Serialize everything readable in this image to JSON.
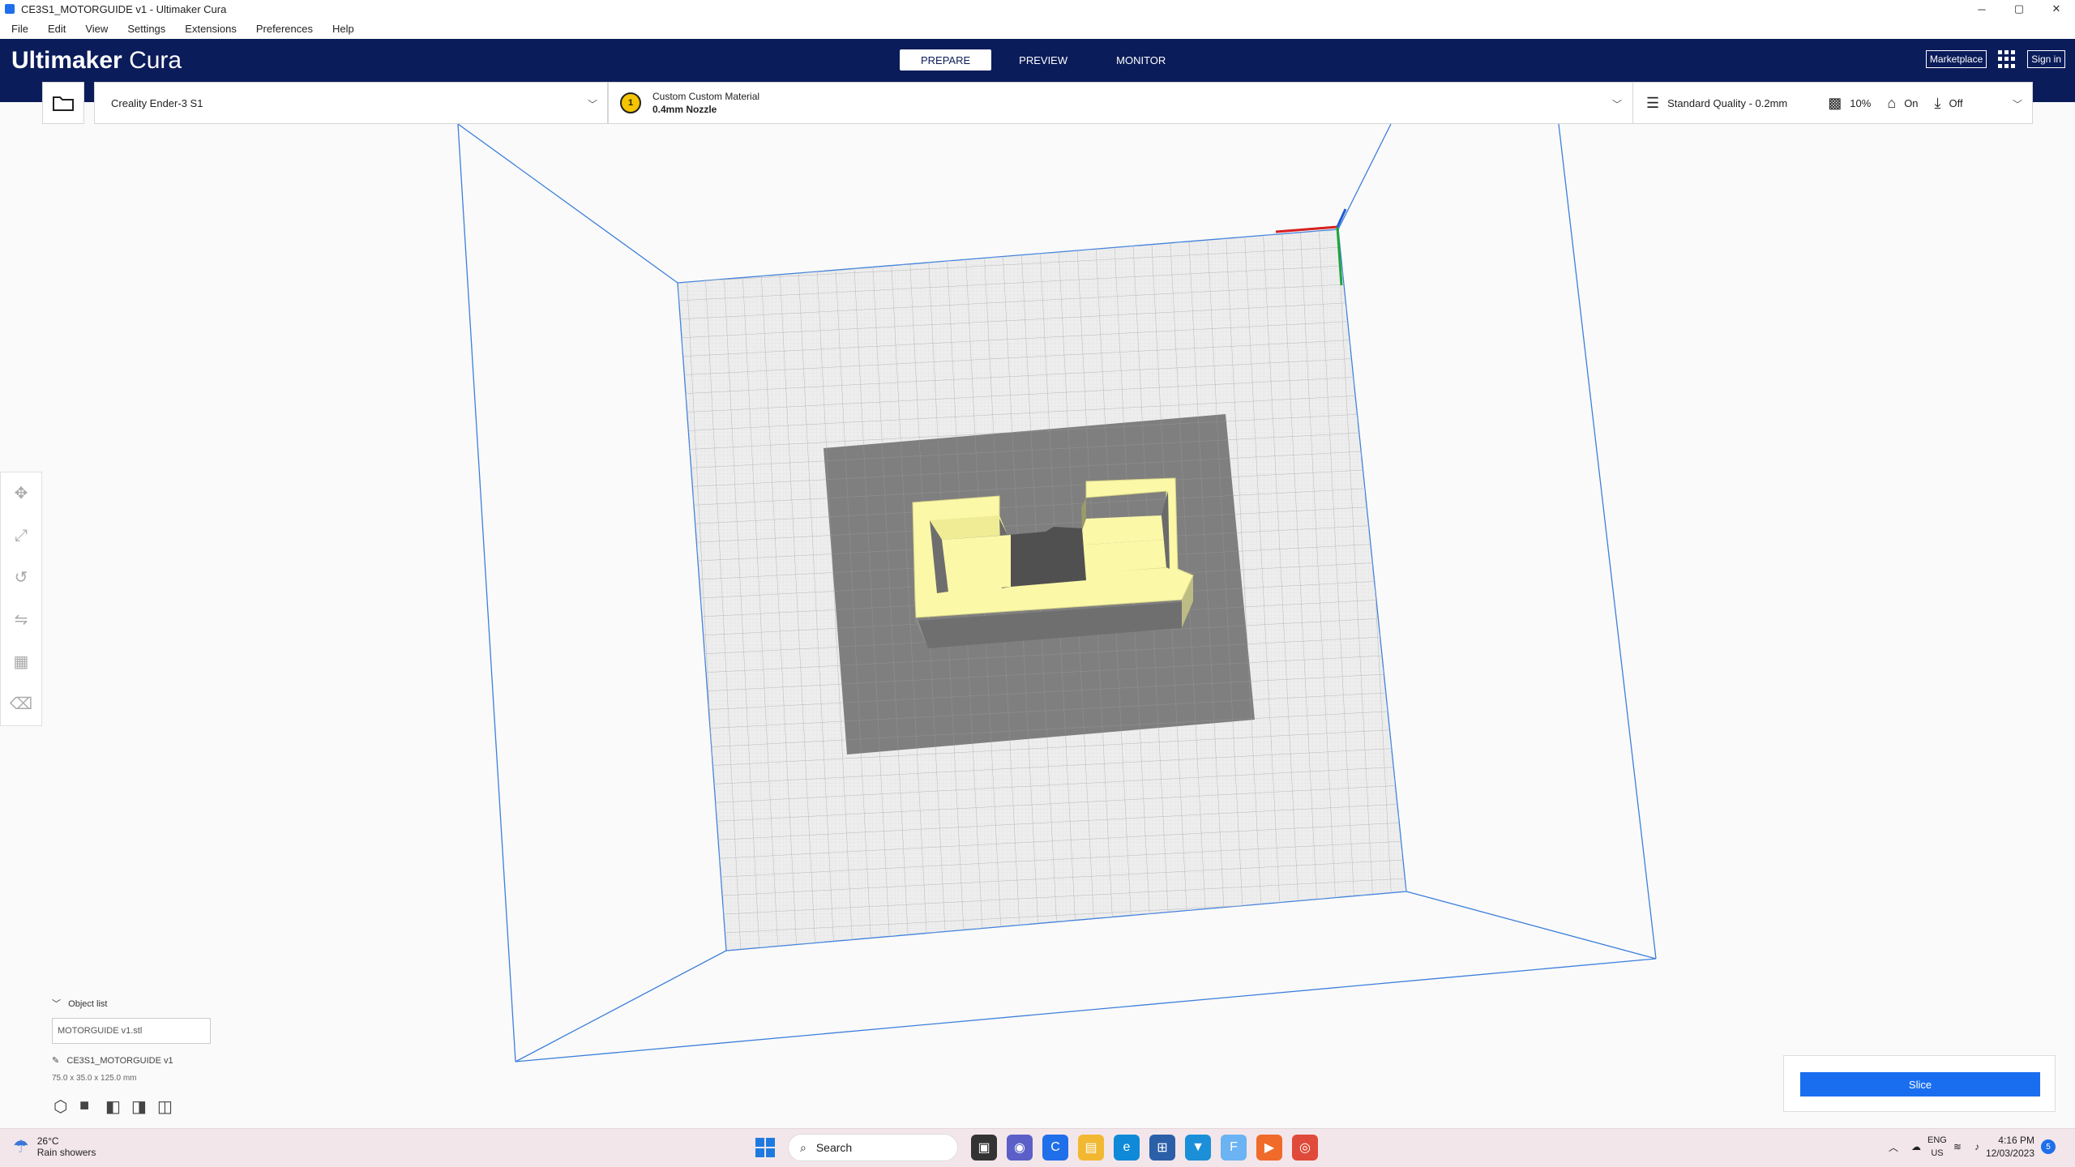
{
  "window": {
    "title": "CE3S1_MOTORGUIDE v1 - Ultimaker Cura",
    "controls": [
      "─",
      "▢",
      "✕"
    ]
  },
  "menu": [
    "File",
    "Edit",
    "View",
    "Settings",
    "Extensions",
    "Preferences",
    "Help"
  ],
  "header": {
    "brand_bold": "Ultimaker",
    "brand_light": " Cura",
    "stages": [
      "PREPARE",
      "PREVIEW",
      "MONITOR"
    ],
    "active_stage": "PREPARE",
    "marketplace": "Marketplace",
    "sign_in": "Sign in"
  },
  "toolbar": {
    "printer": "Creality Ender-3 S1",
    "extruder_number": "1",
    "material": "Custom Custom Material",
    "nozzle": "0.4mm Nozzle",
    "quality": "Standard Quality - 0.2mm",
    "infill": "10%",
    "support": "On",
    "adhesion": "Off"
  },
  "object_list": {
    "header": "Object list",
    "file": "MOTORGUIDE v1.stl",
    "job_name": "CE3S1_MOTORGUIDE v1",
    "dimensions": "75.0 x 35.0 x 125.0 mm"
  },
  "slice": {
    "label": "Slice"
  },
  "taskbar": {
    "temperature": "26°C",
    "weather": "Rain showers",
    "search": "Search",
    "lang": "ENG",
    "region": "US",
    "time": "4:16 PM",
    "date": "12/03/2023",
    "notifications": "5"
  },
  "colors": {
    "header": "#0b1c5a",
    "accent": "#196ef0",
    "model": "#fbf8a8",
    "build_plate": "#eeeeee",
    "shadow": "#808080",
    "volume_lines": "#3d7fdc"
  }
}
